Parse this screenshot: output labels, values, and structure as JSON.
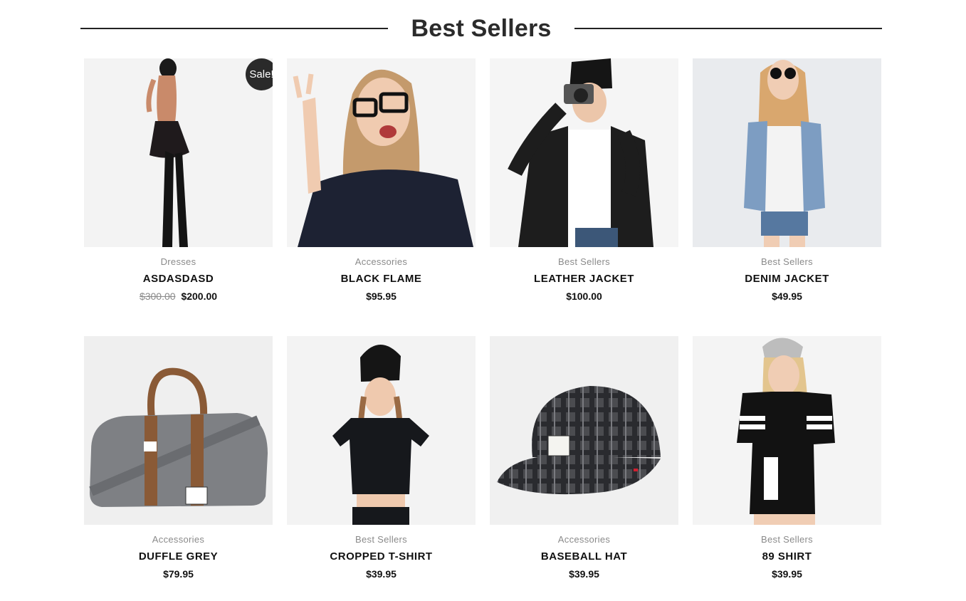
{
  "section": {
    "title": "Best Sellers"
  },
  "products": [
    {
      "category": "Dresses",
      "name": "ASDASDASD",
      "old_price": "$300.00",
      "price": "$200.00",
      "badge": "Sale!",
      "image": "black-dress-model"
    },
    {
      "category": "Accessories",
      "name": "BLACK FLAME",
      "price": "$95.95",
      "image": "glasses-sweater-model"
    },
    {
      "category": "Best Sellers",
      "name": "LEATHER JACKET",
      "price": "$100.00",
      "image": "leather-jacket-camera-model"
    },
    {
      "category": "Best Sellers",
      "name": "DENIM JACKET",
      "price": "$49.95",
      "image": "denim-jacket-model"
    },
    {
      "category": "Accessories",
      "name": "DUFFLE GREY",
      "price": "$79.95",
      "image": "grey-duffle-bag"
    },
    {
      "category": "Best Sellers",
      "name": "CROPPED T-SHIRT",
      "price": "$39.95",
      "image": "cropped-tshirt-model"
    },
    {
      "category": "Accessories",
      "name": "BASEBALL HAT",
      "price": "$39.95",
      "image": "plaid-baseball-hat"
    },
    {
      "category": "Best Sellers",
      "name": "89 SHIRT",
      "price": "$39.95",
      "image": "printed-shirt-model"
    }
  ]
}
